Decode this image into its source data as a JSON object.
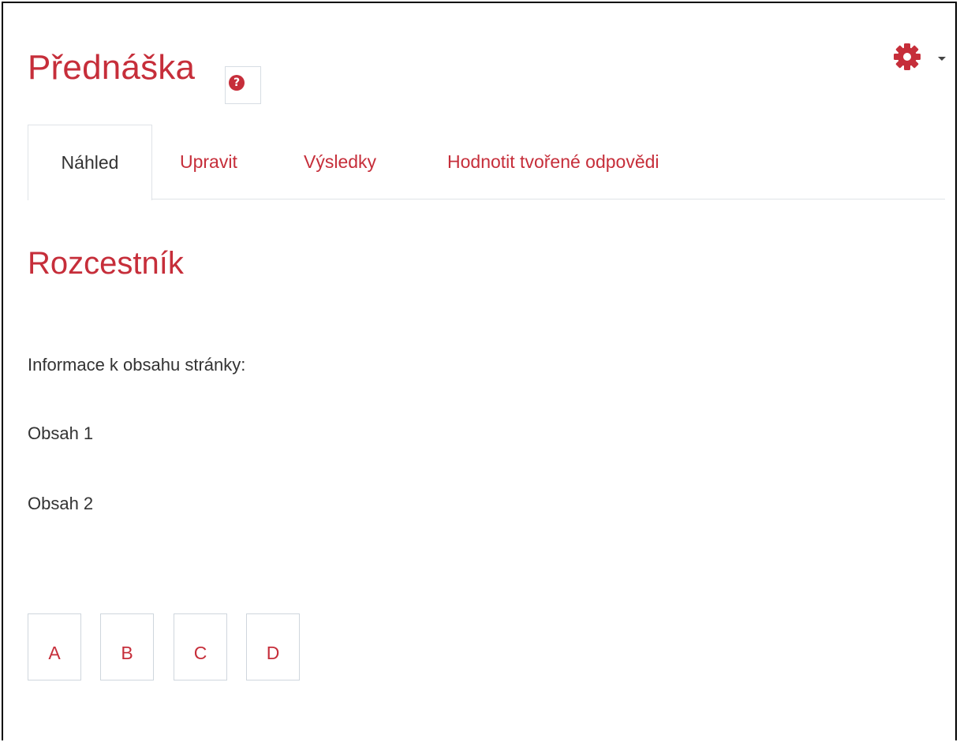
{
  "page": {
    "title": "Přednáška",
    "help_icon": "question-circle-icon",
    "settings_icon": "gear-icon",
    "accent_color": "#c62e3a"
  },
  "tabs": [
    {
      "label": "Náhled",
      "active": true
    },
    {
      "label": "Upravit",
      "active": false
    },
    {
      "label": "Výsledky",
      "active": false
    },
    {
      "label": "Hodnotit tvořené odpovědi",
      "active": false
    }
  ],
  "content": {
    "heading": "Rozcestník",
    "paragraphs": [
      "Informace k obsahu stránky:",
      "Obsah 1",
      "Obsah 2"
    ]
  },
  "buttons": [
    "A",
    "B",
    "C",
    "D"
  ]
}
